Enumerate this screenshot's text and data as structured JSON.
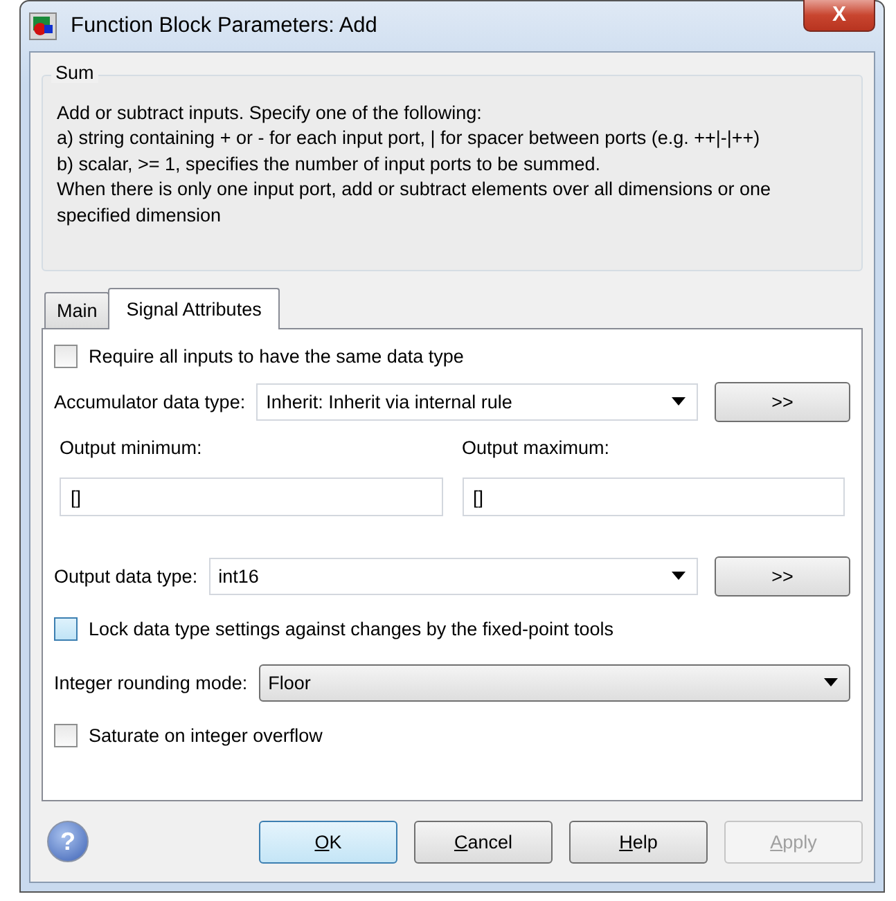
{
  "window": {
    "title": "Function Block Parameters: Add",
    "close": "X"
  },
  "group": {
    "title": "Sum",
    "lines": [
      "Add or subtract inputs.  Specify one of the following:",
      "a) string containing + or - for each input port, | for spacer between ports (e.g. ++|-|++)",
      "b) scalar, >= 1, specifies the number of input ports to be summed.",
      "When there is only one input port, add or subtract elements over all dimensions or one",
      "specified dimension"
    ]
  },
  "tabs": [
    {
      "label": "Main",
      "selected": false
    },
    {
      "label": "Signal Attributes",
      "selected": true
    }
  ],
  "rows": [
    {
      "kind": "checkbox",
      "label": "Require all inputs to have the same data type",
      "checked": false,
      "highlighted": false
    },
    {
      "kind": "combo",
      "label": "Accumulator data type:",
      "value": "Inherit: Inherit via internal rule",
      "editable": true,
      "more": ">>"
    },
    {
      "kind": "fields",
      "fields": [
        {
          "label": "Output minimum:",
          "value": "[]"
        },
        {
          "label": "Output maximum:",
          "value": "[]"
        }
      ]
    },
    {
      "kind": "combo",
      "label": "Output data type:",
      "value": "int16",
      "editable": true,
      "more": ">>"
    },
    {
      "kind": "checkbox",
      "label": "Lock data type settings against changes by the fixed-point tools",
      "checked": false,
      "highlighted": true
    },
    {
      "kind": "combo",
      "label": "Integer rounding mode:",
      "value": "Floor",
      "editable": false
    },
    {
      "kind": "checkbox",
      "label": "Saturate on integer overflow",
      "checked": false,
      "highlighted": false
    }
  ],
  "help": "?",
  "buttons": [
    {
      "label": "OK",
      "default": true,
      "disabled": false,
      "underline_first": true
    },
    {
      "label": "Cancel",
      "default": false,
      "disabled": false,
      "underline_first": true
    },
    {
      "label": "Help",
      "default": false,
      "disabled": false,
      "underline_first": true
    },
    {
      "label": "Apply",
      "default": false,
      "disabled": true,
      "underline_first": true
    }
  ]
}
